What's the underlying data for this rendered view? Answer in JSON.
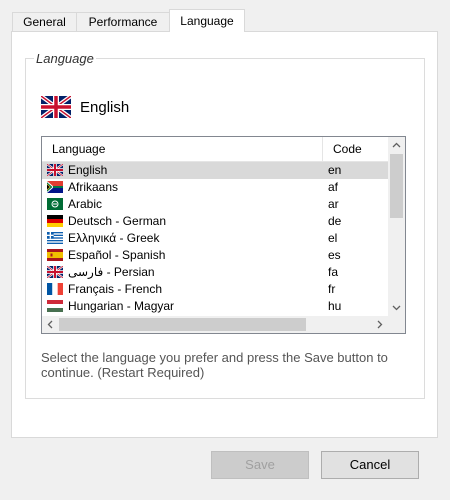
{
  "tabs": [
    {
      "label": "General"
    },
    {
      "label": "Performance"
    },
    {
      "label": "Language",
      "active": true
    }
  ],
  "group": {
    "legend": "Language"
  },
  "current_language": {
    "name": "English",
    "flag": "uk-flag-icon"
  },
  "list": {
    "columns": [
      "Language",
      "Code"
    ],
    "rows": [
      {
        "name": "English",
        "code": "en",
        "flag": "uk-flag-icon",
        "selected": true
      },
      {
        "name": "Afrikaans",
        "code": "af",
        "flag": "south-africa-flag-icon"
      },
      {
        "name": "Arabic",
        "code": "ar",
        "flag": "saudi-flag-icon"
      },
      {
        "name": "Deutsch - German",
        "code": "de",
        "flag": "germany-flag-icon"
      },
      {
        "name": "Ελληνικά - Greek",
        "code": "el",
        "flag": "greece-flag-icon"
      },
      {
        "name": "Español - Spanish",
        "code": "es",
        "flag": "spain-flag-icon"
      },
      {
        "name": "فارسی - Persian",
        "code": "fa",
        "flag": "uk-flag-icon"
      },
      {
        "name": "Français - French",
        "code": "fr",
        "flag": "france-flag-icon"
      },
      {
        "name": "Hungarian - Magyar",
        "code": "hu",
        "flag": "hungary-flag-icon"
      }
    ]
  },
  "description": "Select the language you prefer and press the Save button to continue. (Restart Required)",
  "buttons": {
    "save": "Save",
    "cancel": "Cancel"
  }
}
